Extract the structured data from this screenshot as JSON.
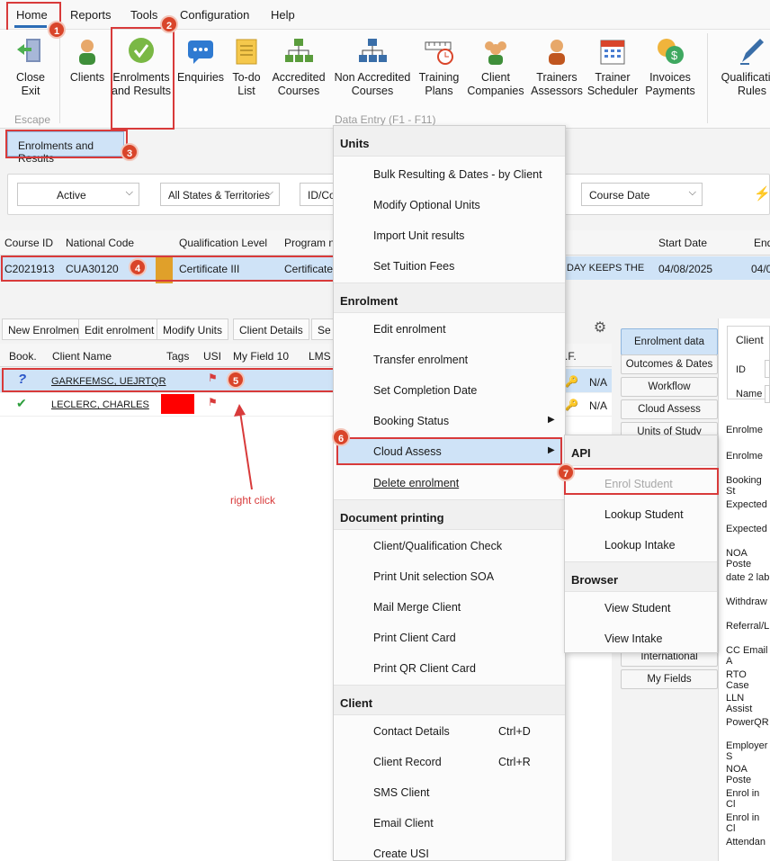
{
  "menubar": {
    "home": "Home",
    "reports": "Reports",
    "tools": "Tools",
    "configuration": "Configuration",
    "help": "Help"
  },
  "ribbon": {
    "close": "Close\nExit",
    "clients": "Clients",
    "enrolments": "Enrolments\nand Results",
    "enquiries": "Enquiries",
    "todo": "To-do\nList",
    "accredited": "Accredited\nCourses",
    "nonaccredited": "Non Accredited\nCourses",
    "training": "Training\nPlans",
    "clientco": "Client\nCompanies",
    "trainers": "Trainers\nAssessors",
    "scheduler": "Trainer\nScheduler",
    "invoices": "Invoices\nPayments",
    "qualification": "Qualification\nRules",
    "group_escape": "Escape",
    "group_data_entry": "Data Entry (F1 - F11)"
  },
  "tab_label": "Enrolments and Results",
  "filters": {
    "status": "Active",
    "states": "All States & Territories",
    "id": "ID/Cod",
    "date_field": "Course Date"
  },
  "course_table": {
    "headers": [
      "Course ID",
      "National Code",
      "Qualification Level",
      "Program na",
      "Start Date",
      "End"
    ],
    "row": {
      "course_id": "C2021913",
      "national_code": "CUA30120",
      "level": "Certificate III",
      "program": "Certificate I",
      "partial": "DAY KEEPS THE",
      "start": "04/08/2025",
      "end": "04/0"
    }
  },
  "toolbar": {
    "new": "New Enrolment",
    "edit": "Edit enrolment",
    "modify": "Modify Units",
    "details": "Client Details",
    "search": "Se"
  },
  "client_table": {
    "headers": [
      "Book.",
      "Client Name",
      "Tags",
      "USI",
      "My Field 10",
      "LMS"
    ],
    "rows": [
      {
        "book": "?",
        "name": "GARKFEMSC, UEJRTQR",
        "na": "N/A"
      },
      {
        "book": "✔",
        "name": "LECLERC, CHARLES",
        "na": "N/A"
      }
    ],
    "af_header": ".F."
  },
  "annotation": {
    "right_click": "right click"
  },
  "badges": [
    "1",
    "2",
    "3",
    "4",
    "5",
    "6",
    "7"
  ],
  "context_menu": {
    "units_header": "Units",
    "bulk": "Bulk Resulting & Dates - by Client",
    "optional": "Modify Optional Units",
    "import": "Import Unit results",
    "tuition": "Set Tuition Fees",
    "enrolment_header": "Enrolment",
    "edit": "Edit enrolment",
    "transfer": "Transfer enrolment",
    "completion": "Set Completion Date",
    "booking": "Booking Status",
    "cloud": "Cloud Assess",
    "delete": "Delete enrolment",
    "doc_header": "Document printing",
    "qualcheck": "Client/Qualification Check",
    "soa": "Print Unit selection SOA",
    "mailmerge": "Mail Merge Client",
    "card": "Print Client Card",
    "qr": "Print QR Client Card",
    "client_header": "Client",
    "contact": "Contact Details",
    "contact_sc": "Ctrl+D",
    "record": "Client Record",
    "record_sc": "Ctrl+R",
    "sms": "SMS Client",
    "email": "Email Client",
    "usi": "Create USI"
  },
  "submenu": {
    "api_header": "API",
    "enrol": "Enrol Student",
    "lookup_student": "Lookup Student",
    "lookup_intake": "Lookup Intake",
    "browser_header": "Browser",
    "view_student": "View Student",
    "view_intake": "View Intake"
  },
  "right_tabs": [
    "Enrolment data",
    "Outcomes & Dates",
    "Workflow",
    "Cloud Assess",
    "Units of Study",
    "International",
    "My Fields"
  ],
  "right_panel": {
    "client_label": "Client",
    "id_label": "ID",
    "name_label": "Name",
    "fields": [
      "Enrolme",
      "Enrolme",
      "Booking St",
      "Expected",
      "Expected",
      "NOA Poste",
      "date 2 lab",
      "Withdraw",
      "Referral/L",
      "CC Email A",
      "RTO Case",
      "LLN Assist",
      "PowerQR",
      "Employer S",
      "NOA Poste",
      "Enrol in Cl",
      "Enrol in Cl",
      "Attendan"
    ]
  },
  "colors": {
    "accent": "#d83a3a",
    "selected_row": "#cfe3f7",
    "badge": "#d9452a"
  }
}
